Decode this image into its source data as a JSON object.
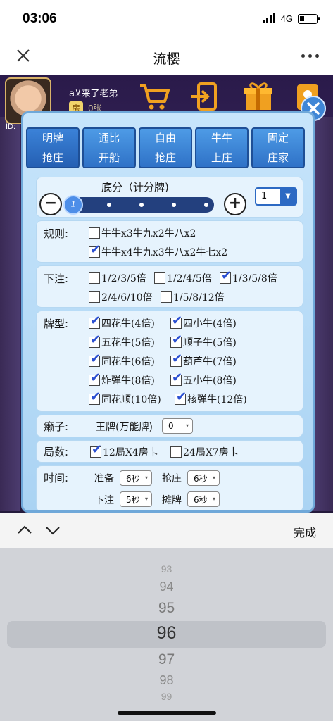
{
  "status": {
    "time": "03:06",
    "network": "4G"
  },
  "nav": {
    "title": "流樱"
  },
  "player": {
    "name": "a⊻来了老弟",
    "id_label": "ID:",
    "room_badge": "房",
    "room_tail": "0张"
  },
  "tabs": [
    {
      "line1": "明牌",
      "line2": "抢庄"
    },
    {
      "line1": "通比",
      "line2": "开船"
    },
    {
      "line1": "自由",
      "line2": "抢庄"
    },
    {
      "line1": "牛牛",
      "line2": "上庄"
    },
    {
      "line1": "固定",
      "line2": "庄家"
    }
  ],
  "base_score": {
    "title": "底分（计分牌)",
    "knob": "1",
    "selected": "1",
    "minus": "−",
    "plus": "+"
  },
  "rules": {
    "label": "规则:",
    "options": [
      {
        "text": "牛牛x3牛九x2牛八x2",
        "checked": false
      },
      {
        "text": "牛牛x4牛九x3牛八x2牛七x2",
        "checked": true
      }
    ]
  },
  "bet": {
    "label": "下注:",
    "options": [
      {
        "text": "1/2/3/5倍",
        "checked": false
      },
      {
        "text": "1/2/4/5倍",
        "checked": false
      },
      {
        "text": "1/3/5/8倍",
        "checked": true
      },
      {
        "text": "2/4/6/10倍",
        "checked": false
      },
      {
        "text": "1/5/8/12倍",
        "checked": false
      }
    ]
  },
  "card_types": {
    "label": "牌型:",
    "options": [
      {
        "text": "四花牛(4倍)",
        "checked": true
      },
      {
        "text": "四小牛(4倍)",
        "checked": true
      },
      {
        "text": "五花牛(5倍)",
        "checked": true
      },
      {
        "text": "顺子牛(5倍)",
        "checked": true
      },
      {
        "text": "同花牛(6倍)",
        "checked": true
      },
      {
        "text": "葫芦牛(7倍)",
        "checked": true
      },
      {
        "text": "炸弹牛(8倍)",
        "checked": true
      },
      {
        "text": "五小牛(8倍)",
        "checked": true
      },
      {
        "text": "同花顺(10倍)",
        "checked": true
      },
      {
        "text": "核弹牛(12倍)",
        "checked": true
      }
    ]
  },
  "wild": {
    "label": "癞子:",
    "text": "王牌(万能牌)",
    "value": "0"
  },
  "rounds": {
    "label": "局数:",
    "options": [
      {
        "text": "12局X4房卡",
        "checked": true
      },
      {
        "text": "24局X7房卡",
        "checked": false
      }
    ]
  },
  "timing": {
    "label": "时间:",
    "items": [
      {
        "name": "准备",
        "value": "6秒"
      },
      {
        "name": "抢庄",
        "value": "6秒"
      },
      {
        "name": "下注",
        "value": "5秒"
      },
      {
        "name": "摊牌",
        "value": "6秒"
      }
    ]
  },
  "picker": {
    "done_label": "完成",
    "values": [
      "93",
      "94",
      "95",
      "96",
      "97",
      "98",
      "99"
    ],
    "selected": "96"
  },
  "colors": {
    "accent": "#2f72c7",
    "panel": "#c7e5fb",
    "check": "#2a4fd1"
  }
}
